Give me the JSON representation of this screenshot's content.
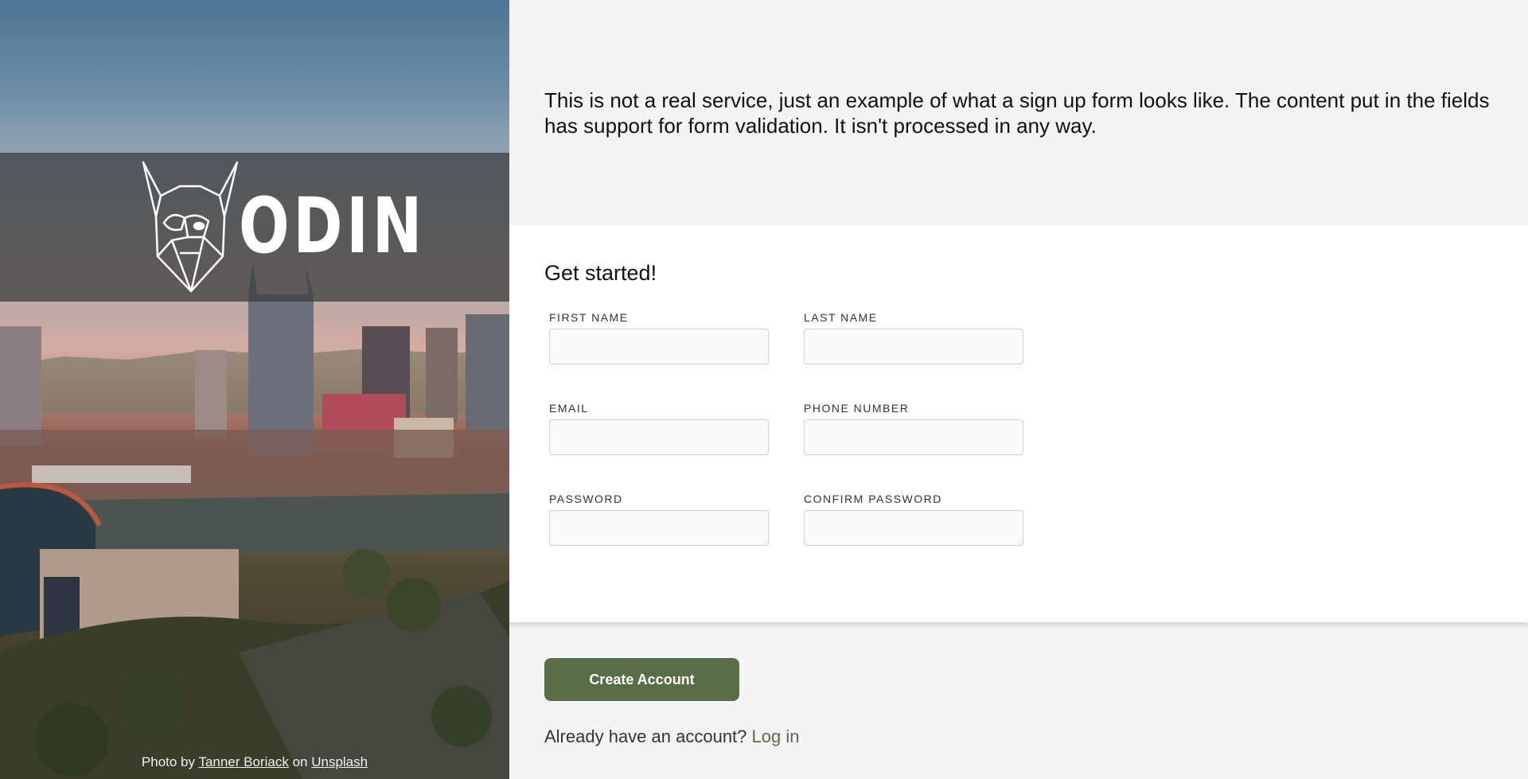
{
  "brand": {
    "logo_text": "ODIN",
    "logo_icon": "viking-dog-icon"
  },
  "photo_credit": {
    "prefix": "Photo by",
    "author": "Tanner Boriack",
    "middle": "on",
    "source": "Unsplash"
  },
  "intro": {
    "text": "This is not a real service, just an example of what a sign up form looks like. The content put in the fields has support for form validation. It isn't processed in any way."
  },
  "form": {
    "heading": "Get started!",
    "fields": {
      "first_name": {
        "label": "FIRST NAME",
        "value": ""
      },
      "last_name": {
        "label": "LAST NAME",
        "value": ""
      },
      "email": {
        "label": "EMAIL",
        "value": ""
      },
      "phone": {
        "label": "PHONE NUMBER",
        "value": ""
      },
      "password": {
        "label": "PASSWORD",
        "value": ""
      },
      "confirm_password": {
        "label": "CONFIRM PASSWORD",
        "value": ""
      }
    }
  },
  "actions": {
    "create_label": "Create Account",
    "login_prompt": "Already have an account?",
    "login_link": "Log in"
  },
  "colors": {
    "accent": "#596d48",
    "panel": "#f4f4f4",
    "card": "#ffffff"
  }
}
